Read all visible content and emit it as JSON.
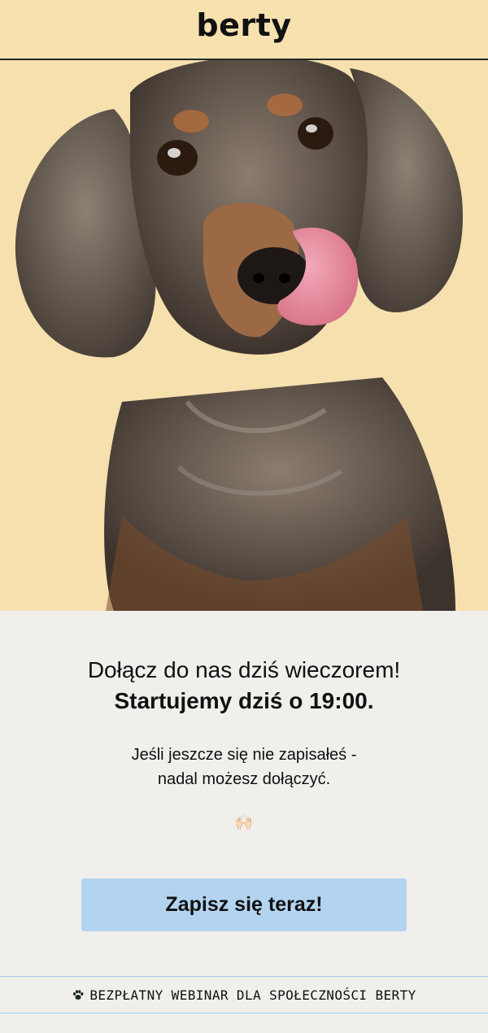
{
  "header": {
    "logo": "berty"
  },
  "hero": {
    "image_alt": "dachshund-licking-nose",
    "background": "#f6e0ae"
  },
  "content": {
    "headline_line1": "Dołącz do nas dziś wieczorem!",
    "headline_line2": "Startujemy dziś o 19:00.",
    "body_line1": "Jeśli jeszcze się nie zapisałeś -",
    "body_line2": "nadal możesz dołączyć.",
    "emoji": "🙌🏻",
    "cta_label": "Zapisz się teraz!"
  },
  "footer": {
    "text": "BEZPŁATNY WEBINAR DLA SPOŁECZNOŚCI BERTY",
    "icon": "paw-icon"
  },
  "colors": {
    "header_bg": "#f6e1af",
    "cta_bg": "#b3d4f0",
    "page_bg": "#f0efeb",
    "footer_border": "#a9cdea"
  }
}
